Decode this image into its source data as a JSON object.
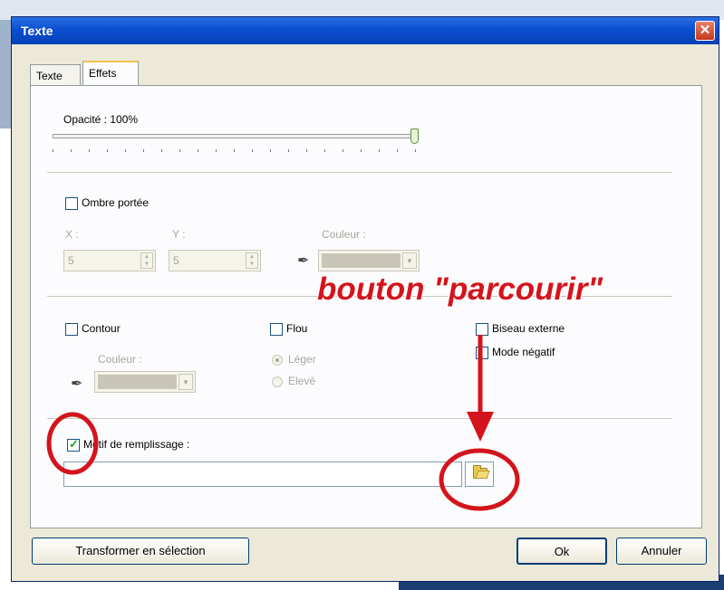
{
  "window": {
    "title": "Texte",
    "close_glyph": "✕"
  },
  "tabs": [
    {
      "label": "Texte",
      "active": false
    },
    {
      "label": "Effets",
      "active": true
    }
  ],
  "opacity": {
    "label": "Opacité : 100%",
    "value_percent": 100
  },
  "drop_shadow": {
    "label": "Ombre portée",
    "checked": false,
    "x_label": "X :",
    "x_value": "5",
    "y_label": "Y :",
    "y_value": "5",
    "color_label": "Couleur :"
  },
  "outline": {
    "label": "Contour",
    "checked": false,
    "color_label": "Couleur :"
  },
  "blur": {
    "label": "Flou",
    "checked": false,
    "light_label": "Léger",
    "high_label": "Elevé",
    "selected": "light"
  },
  "bevel": {
    "label": "Biseau externe",
    "checked": false
  },
  "negative": {
    "label": "Mode négatif",
    "checked": false
  },
  "fill_pattern": {
    "label": "Motif de remplissage :",
    "checked": true,
    "value": ""
  },
  "buttons": {
    "transform": "Transformer en sélection",
    "ok": "Ok",
    "cancel": "Annuler"
  },
  "annotation": {
    "text": "bouton \"parcourir\"",
    "color": "#d4141c"
  },
  "icons": {
    "dropper": "eyedropper-icon",
    "browse": "folder-open-icon"
  },
  "colors": {
    "title_bar": "#0b4fd1",
    "dialog_bg": "#ece9d8",
    "annotation": "#d4141c"
  }
}
